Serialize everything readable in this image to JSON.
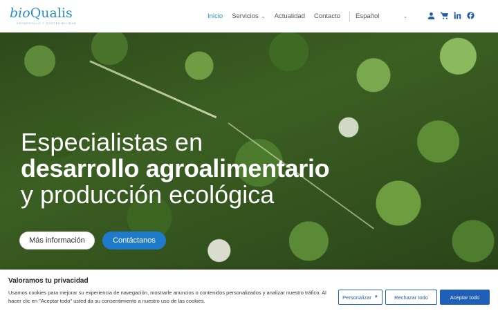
{
  "header": {
    "logo_prefix": "bio",
    "logo_name": "Qualis",
    "logo_tagline": "DESARROLLO Y SOSTENIBILIDAD",
    "nav": [
      {
        "label": "Inicio"
      },
      {
        "label": "Servicios"
      },
      {
        "label": "Actualidad"
      },
      {
        "label": "Contacto"
      }
    ],
    "language": "Español",
    "icons": [
      "user-icon",
      "cart-icon",
      "linkedin-icon",
      "facebook-icon"
    ],
    "accent": "#2a8fc4"
  },
  "hero": {
    "line1": "Especialistas en",
    "line2": "desarrollo agroalimentario",
    "line3": "y producción ecológica",
    "more_button": "Más información",
    "contact_button": "Contáctanos"
  },
  "cookie": {
    "title": "Valoramos tu privacidad",
    "text": "Usamos cookies para mejorar su experiencia de navegación, mostrarle anuncios o contenidos personalizados y analizar nuestro tráfico. Al hacer clic en \"Aceptar todo\" usted da su consentimiento a nuestro uso de las cookies.",
    "personalize": "Personalizar",
    "reject": "Rechazar todo",
    "accept": "Aceptar todo",
    "button_color": "#1f5fb8"
  }
}
